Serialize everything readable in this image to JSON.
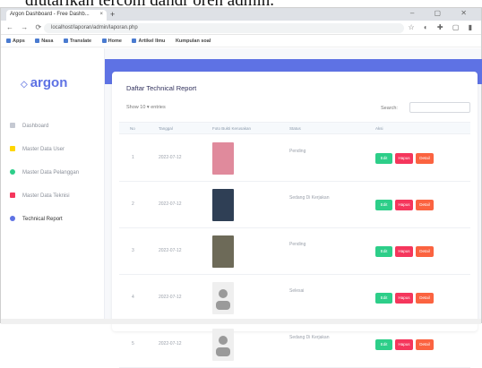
{
  "caption": "diutarikan tercom dandr oren admin.",
  "browser": {
    "tab_title": "Argon Dashboard - Free Dashb...",
    "tab_close": "×",
    "new_tab": "+",
    "window_controls": "– ▢ ✕",
    "nav_buttons": "← → ⟳",
    "url": "localhost/laporan/admin/laporan.php",
    "extension_icons": "☆ ◐ ✚ ▢ ▮",
    "bookmarks": [
      "Apps",
      "Nasa",
      "Translate",
      "Home",
      "Artikel Ilmu",
      "Kumpulan soal"
    ]
  },
  "sidebar": {
    "logo": "argon",
    "items": [
      {
        "label": "Dashboard",
        "color": "#c5c9d2"
      },
      {
        "label": "Master Data User",
        "color": "#ffd600"
      },
      {
        "label": "Master Data Pelanggan",
        "color": "#2dce89"
      },
      {
        "label": "Master Data Teknisi",
        "color": "#f5365c"
      },
      {
        "label": "Technical Report",
        "color": "#5e72e4"
      }
    ]
  },
  "main": {
    "title": "Daftar Technical Report",
    "show_label": "Show 10 ▾ entries",
    "search_label": "Search:",
    "search_value": "",
    "columns": [
      "No",
      "Tanggal",
      "Foto Bukti Kerusakan",
      "Status",
      "Aksi"
    ],
    "rows": [
      {
        "no": "1",
        "date": "2022-07-12",
        "status": "Pending",
        "photo": "#e08a9c"
      },
      {
        "no": "2",
        "date": "2022-07-12",
        "status": "Sedang Di Kerjakan",
        "photo": "#2f3f55"
      },
      {
        "no": "3",
        "date": "2022-07-12",
        "status": "Pending",
        "photo": "#6d6a58"
      },
      {
        "no": "4",
        "date": "2022-07-12",
        "status": "Selesai",
        "photo": "#c4c4c4"
      },
      {
        "no": "5",
        "date": "2022-07-12",
        "status": "Sedang Di Kerjakan",
        "photo": "#c4c4c4"
      }
    ],
    "actions": {
      "edit": "Edit",
      "hapus": "Hapus",
      "detail": "Detail"
    }
  },
  "colors": {
    "accent": "#5e72e4",
    "green": "#2dce89",
    "red": "#f5365c",
    "orange": "#fb6340"
  }
}
